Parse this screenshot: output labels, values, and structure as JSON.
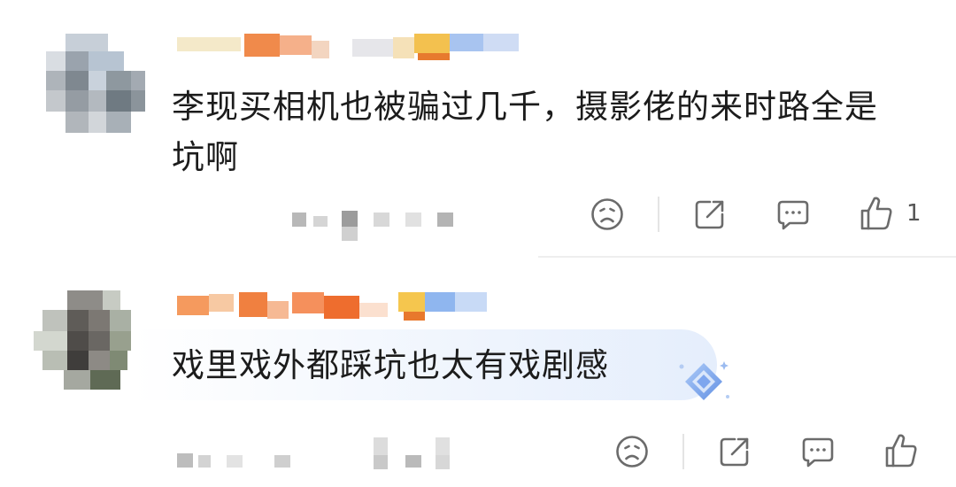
{
  "comments": [
    {
      "text": "李现买相机也被骗过几千，摄影佬的来时路全是坑啊",
      "like_count": "1",
      "actions": [
        "dislike",
        "share",
        "reply",
        "like"
      ]
    },
    {
      "text": "戏里戏外都踩坑也太有戏剧感",
      "like_count": "",
      "actions": [
        "dislike",
        "share",
        "reply",
        "like"
      ],
      "badge_icon": "diamond-gem-icon"
    }
  ],
  "colors": {
    "icon": "#6b6b6b",
    "text": "#1c1c1c",
    "highlight": "#e3ecfb",
    "gem": "#6f9ce8"
  }
}
